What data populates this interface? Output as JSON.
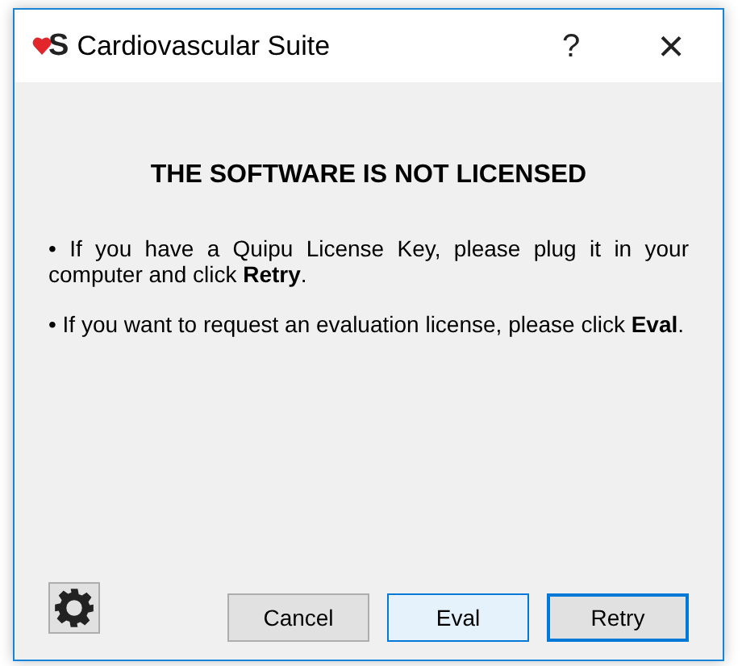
{
  "window": {
    "title": "Cardiovascular Suite",
    "logo_letter": "S",
    "help": "?",
    "close": "×"
  },
  "heading": "THE SOFTWARE IS NOT LICENSED",
  "paragraphs": [
    "• If you have a Quipu License Key, please plug it in your computer and click **Retry**.",
    "• If you want to request an evaluation license, please click **Eval**."
  ],
  "buttons": [
    {
      "label": "Cancel",
      "kind": "normal"
    },
    {
      "label": "Eval",
      "kind": "hover"
    },
    {
      "label": "Retry",
      "kind": "default"
    }
  ]
}
